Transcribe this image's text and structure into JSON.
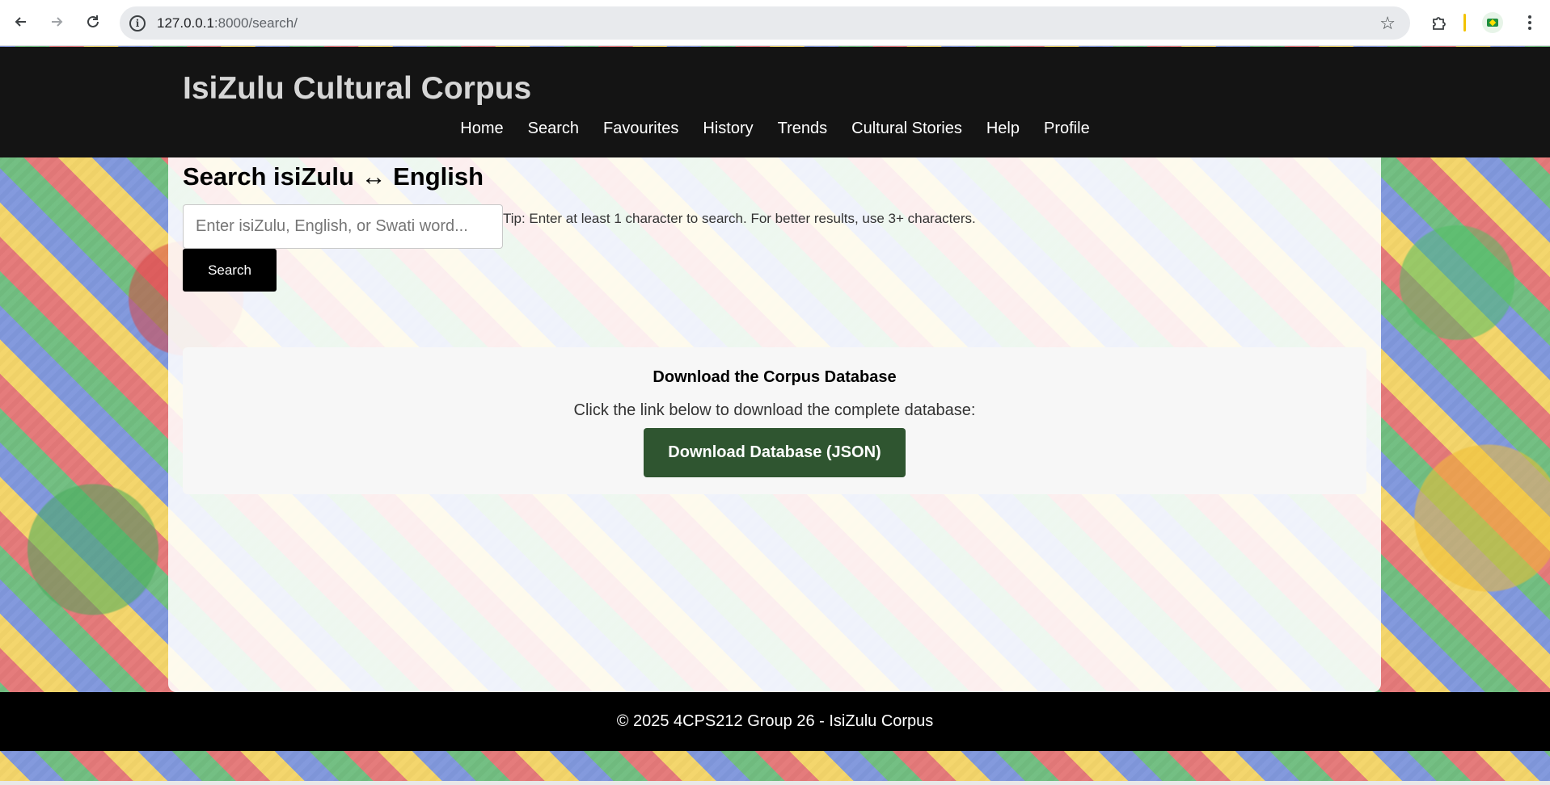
{
  "browser": {
    "url_host": "127.0.0.1",
    "url_rest": ":8000/search/",
    "back_icon": "arrow-left-icon",
    "forward_icon": "arrow-right-icon",
    "reload_icon": "reload-icon"
  },
  "site": {
    "title": "IsiZulu Cultural Corpus",
    "nav": [
      "Home",
      "Search",
      "Favourites",
      "History",
      "Trends",
      "Cultural Stories",
      "Help",
      "Profile"
    ]
  },
  "search": {
    "heading": "Search isiZulu ↔ English",
    "placeholder": "Enter isiZulu, English, or Swati word...",
    "value": "",
    "tip": "Tip: Enter at least 1 character to search. For better results, use 3+ characters.",
    "button_label": "Search"
  },
  "download": {
    "title": "Download the Corpus Database",
    "description": "Click the link below to download the complete database:",
    "button_label": "Download Database (JSON)",
    "button_color": "#2f5530"
  },
  "footer": {
    "text": "© 2025 4CPS212 Group 26 - IsiZulu Corpus"
  }
}
